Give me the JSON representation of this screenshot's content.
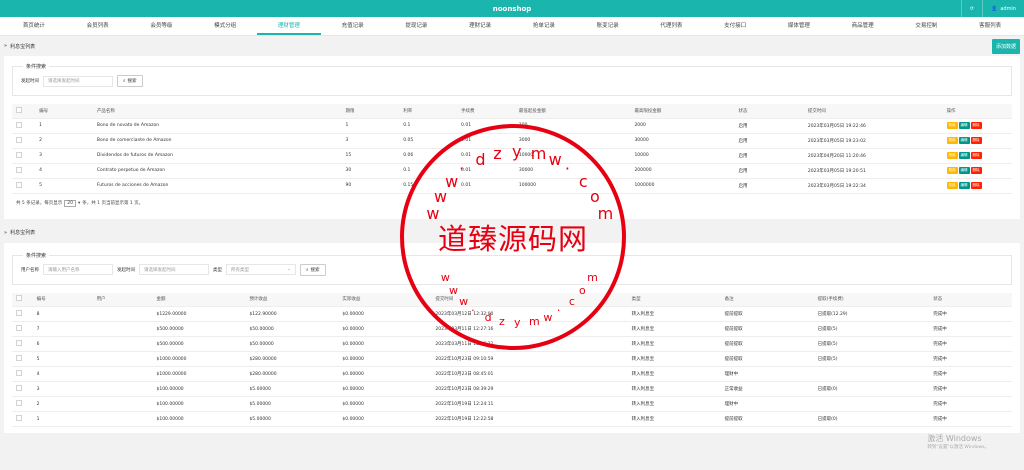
{
  "app": {
    "title": "noonshop",
    "user": "admin"
  },
  "nav": [
    {
      "label": "首页统计"
    },
    {
      "label": "会员列表"
    },
    {
      "label": "会员等级"
    },
    {
      "label": "模式分组"
    },
    {
      "label": "理财管理",
      "active": true
    },
    {
      "label": "充值记录"
    },
    {
      "label": "提现记录"
    },
    {
      "label": "理财记录"
    },
    {
      "label": "抢单记录"
    },
    {
      "label": "账变记录"
    },
    {
      "label": "代理列表"
    },
    {
      "label": "支付接口"
    },
    {
      "label": "媒体管理"
    },
    {
      "label": "商品管理"
    },
    {
      "label": "交易控制"
    },
    {
      "label": "客服列表"
    }
  ],
  "section1": {
    "title": "利息宝列表",
    "add_label": "添加数据",
    "filter_legend": "条件搜索",
    "time_label": "发起时间",
    "time_placeholder": "请选择发起时间",
    "search_label": "搜索",
    "headers": [
      "编号",
      "产品名称",
      "期限",
      "利率",
      "手续费",
      "最低起投金额",
      "最高限投金额",
      "状态",
      "提交时间",
      "操作"
    ],
    "rows": [
      [
        "1",
        "Bono de novato de Amazon",
        "1",
        "0.1",
        "0.01",
        "100",
        "2000",
        "启用",
        "2023年03月05日 19:22:46"
      ],
      [
        "2",
        "Bono de comerciante de Amazon",
        "3",
        "0.05",
        "0.01",
        "3000",
        "30000",
        "启用",
        "2023年03月05日 19:23:02"
      ],
      [
        "3",
        "Dividendos de futuros de Amazon",
        "15",
        "0.06",
        "0.01",
        "10000",
        "10000",
        "启用",
        "2023年04月20日 11:20:46"
      ],
      [
        "4",
        "Contrato perpetuo de Amazon",
        "30",
        "0.1",
        "0.01",
        "30000",
        "200000",
        "启用",
        "2023年03月05日 19:20:51"
      ],
      [
        "5",
        "Futuros de acciones de Amazon",
        "90",
        "0.15",
        "0.01",
        "100000",
        "1000000",
        "启用",
        "2023年03月05日 19:22:34"
      ]
    ],
    "op_labels": [
      "禁用",
      "编辑",
      "删除"
    ],
    "pager": {
      "prefix": "共 5 条记录，每页显示",
      "page_size": "20",
      "suffix": "条，共 1 页当前显示第 1 页。"
    }
  },
  "section2": {
    "title": "利息宝列表",
    "filter_legend": "条件搜索",
    "user_label": "用户名称",
    "user_placeholder": "请输入用户名称",
    "time_label": "发起时间",
    "time_placeholder": "请选择发起时间",
    "type_label": "类型",
    "type_value": "所有类型",
    "search_label": "搜索",
    "headers": [
      "编号",
      "用户",
      "金额",
      "预计收益",
      "实际收益",
      "提交时间",
      "类型",
      "备注",
      "提取(手续费)",
      "状态"
    ],
    "rows": [
      [
        "8",
        "",
        "$1229.00000",
        "$122.90000",
        "$0.00000",
        "2023年03月12日 12:32:00",
        "转入利息宝",
        "提前提取",
        "已提取(12.29)",
        "完成中"
      ],
      [
        "7",
        "",
        "$500.00000",
        "$50.00000",
        "$0.00000",
        "2023年03月11日 12:27:16",
        "转入利息宝",
        "提前提取",
        "已提取(5)",
        "完成中"
      ],
      [
        "6",
        "",
        "$500.00000",
        "$50.00000",
        "$0.00000",
        "2023年03月11日 12:26:22",
        "转入利息宝",
        "提前提取",
        "已提取(5)",
        "完成中"
      ],
      [
        "5",
        "",
        "$1000.00000",
        "$280.00000",
        "$0.00000",
        "2022年10月23日 09:10:59",
        "转入利息宝",
        "提前提取",
        "已提取(5)",
        "完成中"
      ],
      [
        "4",
        "",
        "$1000.00000",
        "$280.00000",
        "$0.00000",
        "2022年10月23日 08:45:01",
        "转入利息宝",
        "理财中",
        "",
        "完成中"
      ],
      [
        "3",
        "",
        "$100.00000",
        "$5.00000",
        "$0.00000",
        "2022年10月23日 08:39:29",
        "转入利息宝",
        "正常收益",
        "已提取(0)",
        "完成中"
      ],
      [
        "2",
        "",
        "$100.00000",
        "$5.00000",
        "$0.00000",
        "2022年10月19日 12:24:11",
        "转入利息宝",
        "理财中",
        "",
        "完成中"
      ],
      [
        "1",
        "",
        "$100.00000",
        "$5.00000",
        "$0.00000",
        "2022年10月19日 12:22:58",
        "转入利息宝",
        "提前提取",
        "已提取(0)",
        "完成中"
      ]
    ]
  },
  "stamp": {
    "main": "道臻源码网",
    "top_letters": [
      "w",
      "w",
      "w",
      "·",
      "d",
      "z",
      "y",
      "m",
      "w",
      "·",
      "c",
      "o",
      "m"
    ],
    "bottom_letters": [
      "w",
      "w",
      "w",
      "·",
      "d",
      "z",
      "y",
      "m",
      "w",
      "·",
      "c",
      "o",
      "m"
    ]
  },
  "watermark": {
    "line1": "激活 Windows",
    "line2": "转到\"设置\"以激活 Windows。"
  }
}
